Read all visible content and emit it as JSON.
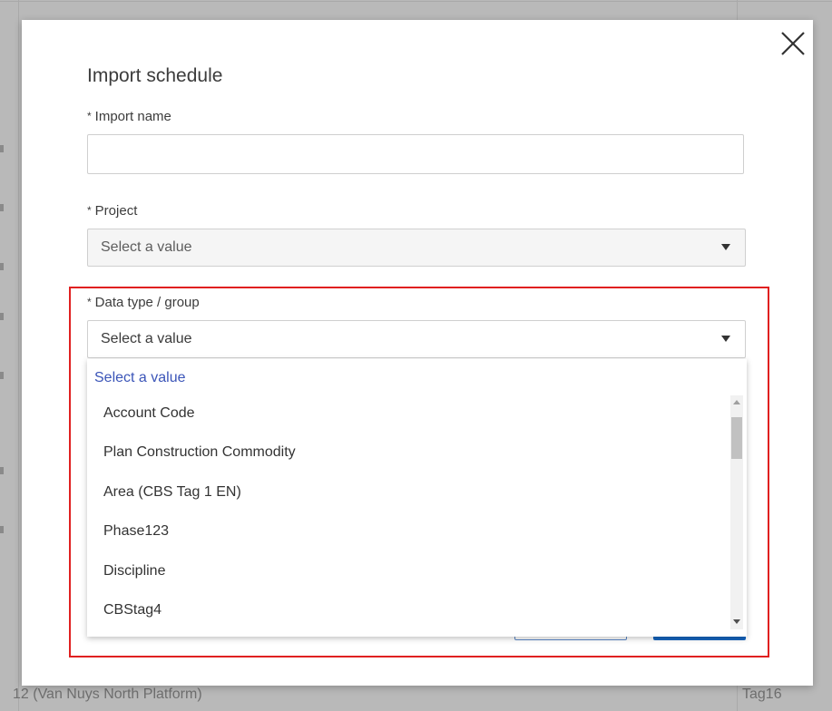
{
  "background": {
    "row_text_left": "12 (Van Nuys North Platform)",
    "row_text_right": "Tag16"
  },
  "dialog": {
    "title": "Import schedule",
    "close_icon": "close-icon",
    "fields": {
      "import_name": {
        "label": "Import name",
        "required_marker": "*",
        "value": ""
      },
      "project": {
        "label": "Project",
        "required_marker": "*",
        "value": "Select a value"
      },
      "data_type_group": {
        "label": "Data type / group",
        "required_marker": "*",
        "value": "Select a value"
      }
    },
    "dropdown": {
      "placeholder": "Select a value",
      "options": [
        "Account Code",
        "Plan Construction Commodity",
        "Area (CBS Tag 1 EN)",
        "Phase123",
        "Discipline",
        "CBStag4"
      ]
    }
  },
  "colors": {
    "highlight": "#e02020",
    "primary": "#1565c0",
    "placeholder_link": "#3b55b8"
  }
}
